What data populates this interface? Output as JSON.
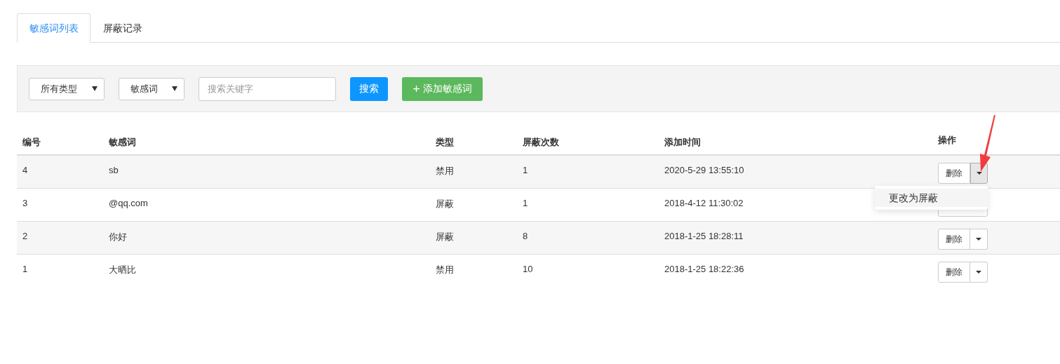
{
  "tabs": [
    {
      "label": "敏感词列表",
      "selected": true
    },
    {
      "label": "屏蔽记录",
      "selected": false
    }
  ],
  "filters": {
    "type_select": "所有类型",
    "field_select": "敏感词",
    "search": {
      "placeholder": "搜索关键字"
    },
    "search_button": "搜索",
    "add_button": {
      "icon": "+",
      "label": "添加敏感词"
    }
  },
  "table": {
    "columns": [
      "编号",
      "敏感词",
      "类型",
      "屏蔽次数",
      "添加时间",
      "操作"
    ],
    "rows": [
      {
        "id": "4",
        "word": "sb",
        "type": "禁用",
        "count": "1",
        "time": "2020-5-29 13:55:10",
        "action": "删除",
        "menu_open": true
      },
      {
        "id": "3",
        "word": "@qq.com",
        "type": "屏蔽",
        "count": "1",
        "time": "2018-4-12 11:30:02",
        "menu_open": false
      },
      {
        "id": "2",
        "word": "你好",
        "type": "屏蔽",
        "count": "8",
        "time": "2018-1-25 18:28:11",
        "action": "删除",
        "menu_open": false
      },
      {
        "id": "1",
        "word": "大晒比",
        "type": "禁用",
        "count": "10",
        "time": "2018-1-25 18:22:36",
        "action": "删除",
        "menu_open": false
      }
    ]
  },
  "dropdown_menu": {
    "items": [
      "更改为屏蔽"
    ]
  }
}
